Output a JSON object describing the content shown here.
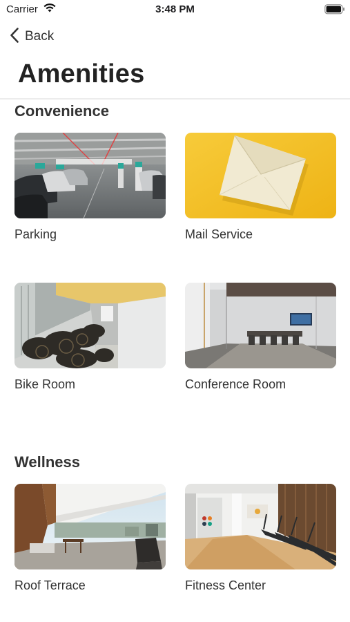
{
  "status_bar": {
    "carrier": "Carrier",
    "time": "3:48 PM"
  },
  "nav": {
    "back_label": "Back"
  },
  "page": {
    "title": "Amenities"
  },
  "sections": [
    {
      "title": "Convenience",
      "items": [
        {
          "label": "Parking",
          "image": "parking-garage-photo"
        },
        {
          "label": "Mail Service",
          "image": "envelope-photo"
        },
        {
          "label": "Bike Room",
          "image": "bike-room-photo"
        },
        {
          "label": "Conference Room",
          "image": "conference-room-photo"
        }
      ]
    },
    {
      "title": "Wellness",
      "items": [
        {
          "label": "Roof Terrace",
          "image": "roof-terrace-photo"
        },
        {
          "label": "Fitness Center",
          "image": "fitness-center-photo"
        }
      ]
    }
  ],
  "colors": {
    "background": "#ffffff",
    "text": "#333333",
    "mail_yellow": "#f4c22b"
  }
}
